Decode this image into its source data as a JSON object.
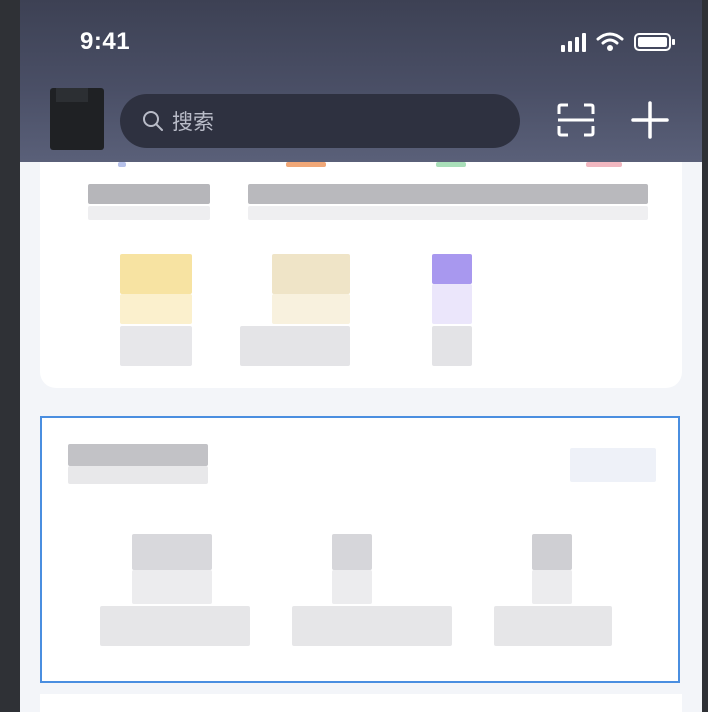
{
  "status_bar": {
    "time": "9:41",
    "icons": [
      "signal-icon",
      "wifi-icon",
      "battery-icon"
    ]
  },
  "header": {
    "search": {
      "placeholder": "搜索",
      "icon": "search-icon"
    },
    "actions": [
      "scan-icon",
      "plus-icon"
    ]
  },
  "colors": {
    "header_top": "#3d4154",
    "header_bottom": "#5a6079",
    "search_bg": "#2e3140",
    "highlight_border": "#4a8ee0",
    "page_bg": "#f3f5f9"
  }
}
